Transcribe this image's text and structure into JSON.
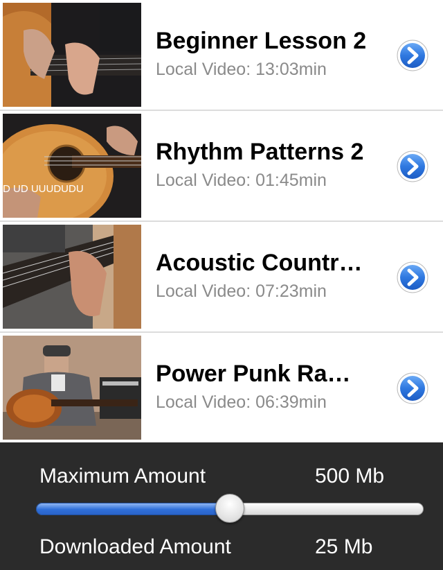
{
  "videos": [
    {
      "title": "Beginner Lesson 2",
      "subtitle": "Local Video: 13:03min",
      "thumbnail_overlay": ""
    },
    {
      "title": "Rhythm Patterns 2",
      "subtitle": "Local Video: 01:45min",
      "thumbnail_overlay": "D UD UUUDUDU"
    },
    {
      "title": "Acoustic Countr…",
      "subtitle": "Local Video: 07:23min",
      "thumbnail_overlay": ""
    },
    {
      "title": "Power Punk Ra…",
      "subtitle": "Local Video: 06:39min",
      "thumbnail_overlay": ""
    }
  ],
  "storage": {
    "max_label": "Maximum Amount",
    "max_value": "500 Mb",
    "downloaded_label": "Downloaded Amount",
    "downloaded_value": "25 Mb",
    "slider_fraction": 0.5
  },
  "colors": {
    "panel_bg": "#2b2b2b",
    "accent_blue": "#2f6fd9",
    "subtitle_gray": "#8a8a8a"
  },
  "icons": {
    "row_action": "detail-disclosure-icon"
  }
}
